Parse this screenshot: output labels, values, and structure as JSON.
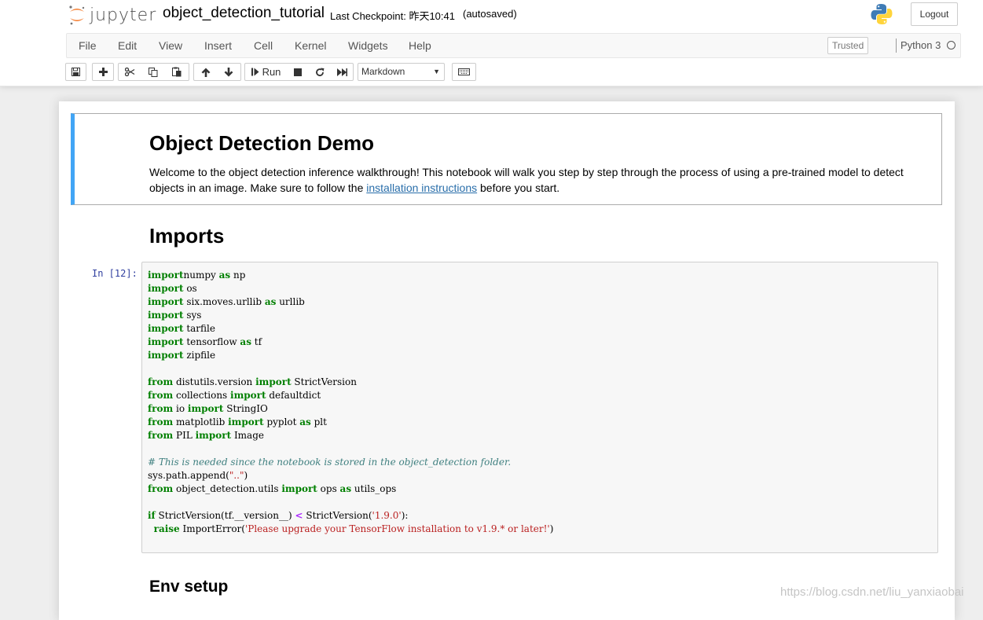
{
  "header": {
    "logo_text": "jupyter",
    "notebook_name": "object_detection_tutorial",
    "checkpoint": "Last Checkpoint: 昨天10:41",
    "autosave": "(autosaved)",
    "logout_label": "Logout"
  },
  "menubar": {
    "items": [
      "File",
      "Edit",
      "View",
      "Insert",
      "Cell",
      "Kernel",
      "Widgets",
      "Help"
    ],
    "trusted_label": "Trusted",
    "kernel_name": "Python 3"
  },
  "toolbar": {
    "run_label": "Run",
    "cell_type": "Markdown",
    "icons": [
      "save-icon",
      "plus-icon",
      "scissors-icon",
      "copy-icon",
      "paste-icon",
      "arrow-up-icon",
      "arrow-down-icon",
      "run-icon",
      "stop-icon",
      "restart-icon",
      "fast-forward-icon",
      "keyboard-icon"
    ]
  },
  "notebook": {
    "title": "Object Detection Demo",
    "intro_before_link": "Welcome to the object detection inference walkthrough! This notebook will walk you step by step through the process of using a pre-trained model to detect objects in an image. Make sure to follow the ",
    "intro_link": "installation instructions",
    "intro_after_link": " before you start.",
    "imports_heading": "Imports",
    "prompt": "In [12]:",
    "code_lines": [
      [
        [
          "kw",
          "import"
        ],
        [
          "",
          "numpy "
        ],
        [
          "kw",
          "as"
        ],
        [
          "",
          " np"
        ]
      ],
      [
        [
          "kw",
          "import"
        ],
        [
          "",
          " os"
        ]
      ],
      [
        [
          "kw",
          "import"
        ],
        [
          "",
          " six.moves.urllib "
        ],
        [
          "kw",
          "as"
        ],
        [
          "",
          " urllib"
        ]
      ],
      [
        [
          "kw",
          "import"
        ],
        [
          "",
          " sys"
        ]
      ],
      [
        [
          "kw",
          "import"
        ],
        [
          "",
          " tarfile"
        ]
      ],
      [
        [
          "kw",
          "import"
        ],
        [
          "",
          " tensorflow "
        ],
        [
          "kw",
          "as"
        ],
        [
          "",
          " tf"
        ]
      ],
      [
        [
          "kw",
          "import"
        ],
        [
          "",
          " zipfile"
        ]
      ],
      [],
      [
        [
          "kw",
          "from"
        ],
        [
          "",
          " distutils.version "
        ],
        [
          "kw",
          "import"
        ],
        [
          "",
          " StrictVersion"
        ]
      ],
      [
        [
          "kw",
          "from"
        ],
        [
          "",
          " collections "
        ],
        [
          "kw",
          "import"
        ],
        [
          "",
          " defaultdict"
        ]
      ],
      [
        [
          "kw",
          "from"
        ],
        [
          "",
          " io "
        ],
        [
          "kw",
          "import"
        ],
        [
          "",
          " StringIO"
        ]
      ],
      [
        [
          "kw",
          "from"
        ],
        [
          "",
          " matplotlib "
        ],
        [
          "kw",
          "import"
        ],
        [
          "",
          " pyplot "
        ],
        [
          "kw",
          "as"
        ],
        [
          "",
          " plt"
        ]
      ],
      [
        [
          "kw",
          "from"
        ],
        [
          "",
          " PIL "
        ],
        [
          "kw",
          "import"
        ],
        [
          "",
          " Image"
        ]
      ],
      [],
      [
        [
          "cm",
          "# This is needed since the notebook is stored in the object_detection folder."
        ]
      ],
      [
        [
          "",
          "sys.path.append("
        ],
        [
          "st",
          "\"..\""
        ],
        [
          "",
          ")"
        ]
      ],
      [
        [
          "kw",
          "from"
        ],
        [
          "",
          " object_detection.utils "
        ],
        [
          "kw",
          "import"
        ],
        [
          "",
          " ops "
        ],
        [
          "kw",
          "as"
        ],
        [
          "",
          " utils_ops"
        ]
      ],
      [],
      [
        [
          "kw",
          "if"
        ],
        [
          "",
          " StrictVersion(tf.__version__) "
        ],
        [
          "op",
          "<"
        ],
        [
          "",
          " StrictVersion("
        ],
        [
          "st",
          "'1.9.0'"
        ],
        [
          "",
          "):"
        ]
      ],
      [
        [
          "",
          "  "
        ],
        [
          "kw",
          "raise"
        ],
        [
          "",
          " ImportError("
        ],
        [
          "st",
          "'Please upgrade your TensorFlow installation to v1.9.* or later!'"
        ],
        [
          "",
          ")"
        ]
      ]
    ],
    "env_heading": "Env setup"
  },
  "watermark": "https://blog.csdn.net/liu_yanxiaobai",
  "colors": {
    "selected_cell_border": "#42a5f5",
    "keyword": "#008000",
    "comment": "#408080",
    "string": "#ba2121",
    "prompt": "#303f9f"
  }
}
